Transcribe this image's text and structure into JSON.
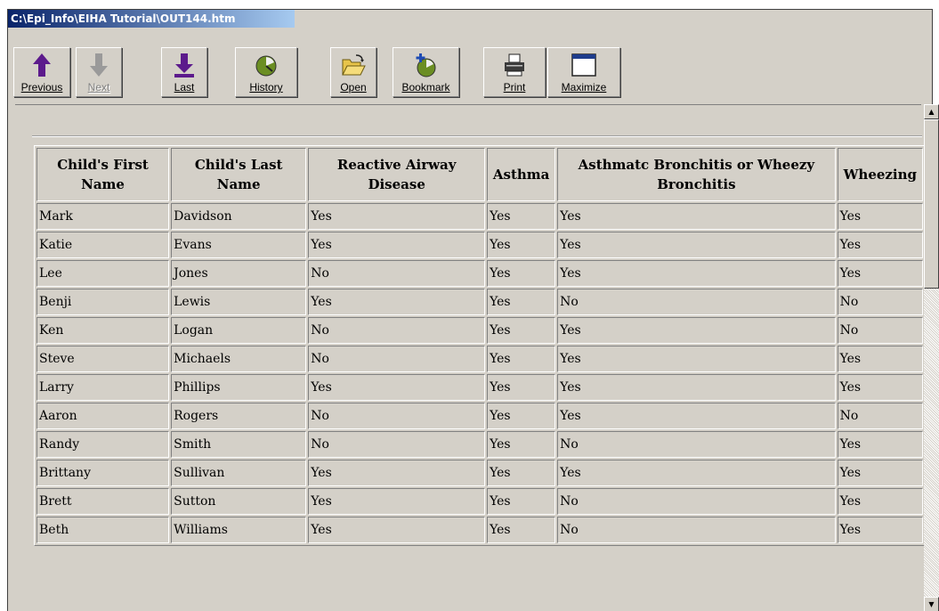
{
  "window": {
    "title": "C:\\Epi_Info\\EIHA Tutorial\\OUT144.htm"
  },
  "toolbar": {
    "previous": {
      "label": "Previous",
      "icon": "up-arrow-icon"
    },
    "next": {
      "label": "Next",
      "icon": "down-arrow-icon"
    },
    "last": {
      "label": "Last",
      "icon": "last-page-icon"
    },
    "history": {
      "label": "History",
      "icon": "history-icon"
    },
    "open": {
      "label": "Open",
      "icon": "open-folder-icon"
    },
    "bookmark": {
      "label": "Bookmark",
      "icon": "bookmark-icon"
    },
    "print": {
      "label": "Print",
      "icon": "printer-icon"
    },
    "maximize": {
      "label": "Maximize",
      "icon": "maximize-window-icon"
    }
  },
  "table": {
    "headers": [
      "Child's First Name",
      "Child's Last Name",
      "Reactive Airway Disease",
      "Asthma",
      "Asthmatc Bronchitis or Wheezy Bronchitis",
      "Wheezing"
    ],
    "rows": [
      [
        "Mark",
        "Davidson",
        "Yes",
        "Yes",
        "Yes",
        "Yes"
      ],
      [
        "Katie",
        "Evans",
        "Yes",
        "Yes",
        "Yes",
        "Yes"
      ],
      [
        "Lee",
        "Jones",
        "No",
        "Yes",
        "Yes",
        "Yes"
      ],
      [
        "Benji",
        "Lewis",
        "Yes",
        "Yes",
        "No",
        "No"
      ],
      [
        "Ken",
        "Logan",
        "No",
        "Yes",
        "Yes",
        "No"
      ],
      [
        "Steve",
        "Michaels",
        "No",
        "Yes",
        "Yes",
        "Yes"
      ],
      [
        "Larry",
        "Phillips",
        "Yes",
        "Yes",
        "Yes",
        "Yes"
      ],
      [
        "Aaron",
        "Rogers",
        "No",
        "Yes",
        "Yes",
        "No"
      ],
      [
        "Randy",
        "Smith",
        "No",
        "Yes",
        "No",
        "Yes"
      ],
      [
        "Brittany",
        "Sullivan",
        "Yes",
        "Yes",
        "Yes",
        "Yes"
      ],
      [
        "Brett",
        "Sutton",
        "Yes",
        "Yes",
        "No",
        "Yes"
      ],
      [
        "Beth",
        "Williams",
        "Yes",
        "Yes",
        "No",
        "Yes"
      ]
    ]
  },
  "colors": {
    "face": "#d4d0c8",
    "title_bar": "#0a246a",
    "arrow_purple": "#5c1a8c"
  }
}
